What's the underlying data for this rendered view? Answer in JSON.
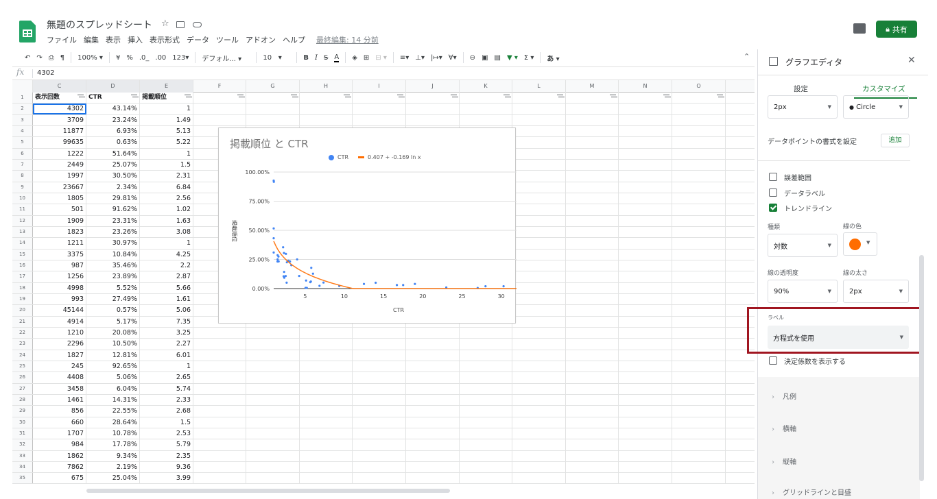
{
  "header": {
    "title": "無題のスプレッドシート",
    "menu": [
      "ファイル",
      "編集",
      "表示",
      "挿入",
      "表示形式",
      "データ",
      "ツール",
      "アドオン",
      "ヘルプ"
    ],
    "last_edit": "最終編集: 14 分前",
    "share_label": "共有"
  },
  "toolbar": {
    "zoom": "100%",
    "currency": "¥",
    "percent": "%",
    "dec_less": ".0_",
    "dec_more": ".00",
    "format": "123",
    "font": "デフォル...",
    "font_size": "10",
    "bold": "B",
    "italic": "I",
    "strike": "S",
    "text_color": "A",
    "input_tool": "あ"
  },
  "formula_bar": {
    "value": "4302"
  },
  "columns": [
    "C",
    "D",
    "E",
    "F",
    "G",
    "H",
    "I",
    "J",
    "K",
    "L",
    "M",
    "N",
    "O"
  ],
  "table": {
    "headers": [
      "表示回数",
      "CTR",
      "掲載順位"
    ],
    "rows": [
      [
        "4302",
        "43.14%",
        "1"
      ],
      [
        "3709",
        "23.24%",
        "1.49"
      ],
      [
        "11877",
        "6.93%",
        "5.13"
      ],
      [
        "99635",
        "0.63%",
        "5.22"
      ],
      [
        "1222",
        "51.64%",
        "1"
      ],
      [
        "2449",
        "25.07%",
        "1.5"
      ],
      [
        "1997",
        "30.50%",
        "2.31"
      ],
      [
        "23667",
        "2.34%",
        "6.84"
      ],
      [
        "1805",
        "29.81%",
        "2.56"
      ],
      [
        "501",
        "91.62%",
        "1.02"
      ],
      [
        "1909",
        "23.31%",
        "1.63"
      ],
      [
        "1823",
        "23.26%",
        "3.08"
      ],
      [
        "1211",
        "30.97%",
        "1"
      ],
      [
        "3375",
        "10.84%",
        "4.25"
      ],
      [
        "987",
        "35.46%",
        "2.2"
      ],
      [
        "1256",
        "23.89%",
        "2.87"
      ],
      [
        "4998",
        "5.52%",
        "5.66"
      ],
      [
        "993",
        "27.49%",
        "1.61"
      ],
      [
        "45144",
        "0.57%",
        "5.06"
      ],
      [
        "4914",
        "5.17%",
        "7.35"
      ],
      [
        "1210",
        "20.08%",
        "3.25"
      ],
      [
        "2296",
        "10.50%",
        "2.27"
      ],
      [
        "1827",
        "12.81%",
        "6.01"
      ],
      [
        "245",
        "92.65%",
        "1"
      ],
      [
        "4408",
        "5.06%",
        "2.65"
      ],
      [
        "3458",
        "6.04%",
        "5.74"
      ],
      [
        "1461",
        "14.31%",
        "2.33"
      ],
      [
        "856",
        "22.55%",
        "2.68"
      ],
      [
        "660",
        "28.64%",
        "1.5"
      ],
      [
        "1707",
        "10.78%",
        "2.53"
      ],
      [
        "984",
        "17.78%",
        "5.79"
      ],
      [
        "1862",
        "9.34%",
        "2.35"
      ],
      [
        "7862",
        "2.19%",
        "9.36"
      ],
      [
        "675",
        "25.04%",
        "3.99"
      ]
    ]
  },
  "chart_data": {
    "type": "scatter",
    "title": "掲載順位 と CTR",
    "xlabel": "CTR",
    "ylabel": "掲載順位",
    "xticks": [
      5,
      10,
      15,
      20,
      25,
      30
    ],
    "yticks": [
      "0.00%",
      "25.00%",
      "50.00%",
      "75.00%",
      "100.00%"
    ],
    "xlim": [
      1,
      33
    ],
    "ylim": [
      0,
      1
    ],
    "legend_position": "top",
    "series": [
      {
        "name": "CTR",
        "color": "#4285f4",
        "x": [
          1,
          1.49,
          5.13,
          5.22,
          1,
          1.5,
          2.31,
          6.84,
          2.56,
          1.02,
          1.63,
          3.08,
          1,
          4.25,
          2.2,
          2.87,
          5.66,
          1.61,
          5.06,
          7.35,
          3.25,
          2.27,
          6.01,
          1,
          2.65,
          5.74,
          2.33,
          2.68,
          1.5,
          2.53,
          5.79,
          2.35,
          9.36,
          3.99,
          12.5,
          14,
          16.7,
          17.5,
          19,
          23,
          27,
          28,
          30.3,
          33
        ],
        "y": [
          0.4314,
          0.2324,
          0.0693,
          0.0063,
          0.5164,
          0.2507,
          0.305,
          0.0234,
          0.2981,
          0.9162,
          0.2331,
          0.2326,
          0.3097,
          0.1084,
          0.3546,
          0.2389,
          0.0552,
          0.2749,
          0.0057,
          0.0517,
          0.2008,
          0.105,
          0.1281,
          0.9265,
          0.0506,
          0.0604,
          0.1431,
          0.2255,
          0.2864,
          0.1078,
          0.1778,
          0.0934,
          0.0219,
          0.2504,
          0.04,
          0.05,
          0.03,
          0.03,
          0.04,
          0.01,
          0.005,
          0.02,
          0.02,
          0.005
        ]
      },
      {
        "name": "0.407 + -0.169 ln x",
        "color": "#ff6d00",
        "type": "trendline",
        "equation": "0.407 + -0.169 ln x"
      }
    ]
  },
  "panel": {
    "title": "グラフエディタ",
    "tabs": [
      "設定",
      "カスタマイズ"
    ],
    "point_size": "2px",
    "point_shape": "Circle",
    "format_points_label": "データポイントの書式を設定",
    "add_label": "追加",
    "checkboxes": [
      {
        "label": "誤差範囲",
        "checked": false
      },
      {
        "label": "データラベル",
        "checked": false
      },
      {
        "label": "トレンドライン",
        "checked": true
      }
    ],
    "type_label": "種類",
    "type_value": "対数",
    "line_color_label": "線の色",
    "line_color": "#ff6d00",
    "opacity_label": "線の透明度",
    "opacity_value": "90%",
    "thickness_label": "線の太さ",
    "thickness_value": "2px",
    "label_label": "ラベル",
    "label_value": "方程式を使用",
    "r2_label": "決定係数を表示する",
    "sections": [
      "凡例",
      "横軸",
      "縦軸",
      "グリッドラインと目盛"
    ]
  }
}
